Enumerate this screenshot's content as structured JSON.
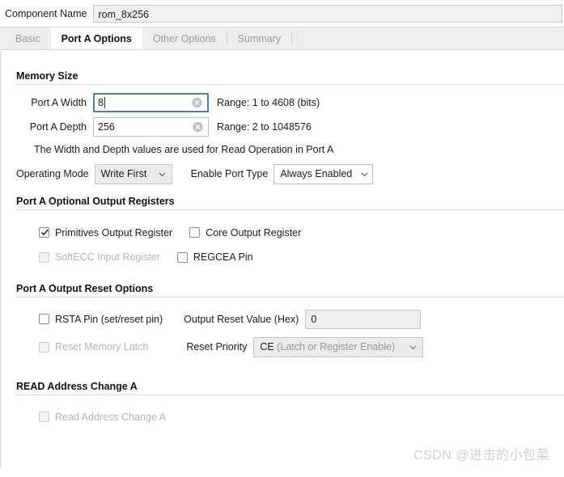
{
  "header": {
    "component_name_label": "Component Name",
    "component_name_value": "rom_8x256"
  },
  "tabs": [
    {
      "label": "Basic",
      "active": false
    },
    {
      "label": "Port A Options",
      "active": true
    },
    {
      "label": "Other Options",
      "active": false
    },
    {
      "label": "Summary",
      "active": false
    }
  ],
  "memory_size": {
    "section_title": "Memory Size",
    "width_label": "Port A Width",
    "width_value": "8",
    "width_range": "Range: 1 to 4608 (bits)",
    "depth_label": "Port A Depth",
    "depth_value": "256",
    "depth_range": "Range: 2 to 1048576",
    "hint": "The Width and Depth values are used for Read Operation in Port A",
    "operating_mode_label": "Operating Mode",
    "operating_mode_value": "Write First",
    "enable_port_type_label": "Enable Port Type",
    "enable_port_type_value": "Always Enabled"
  },
  "optional_output_registers": {
    "section_title": "Port A Optional Output Registers",
    "primitives_output_register": "Primitives Output Register",
    "core_output_register": "Core Output Register",
    "softecc_input_register": "SoftECC Input Register",
    "regcea_pin": "REGCEA Pin"
  },
  "output_reset_options": {
    "section_title": "Port A Output Reset Options",
    "rsta_pin_label": "RSTA Pin (set/reset pin)",
    "output_reset_value_label": "Output Reset Value (Hex)",
    "output_reset_value": "0",
    "reset_memory_latch_label": "Reset Memory Latch",
    "reset_priority_label": "Reset Priority",
    "reset_priority_value": "CE",
    "reset_priority_value_detail": "(Latch or Register Enable)"
  },
  "read_address_change": {
    "section_title": "READ Address Change A",
    "checkbox_label": "Read Address Change A"
  },
  "watermark": "CSDN @进击的小包菜",
  "colors": {
    "focus_border": "#4a7ebb",
    "tab_active_bg": "#ffffff",
    "tabstrip_bg": "#eeeeee",
    "disabled_text": "#b4b4b4"
  }
}
